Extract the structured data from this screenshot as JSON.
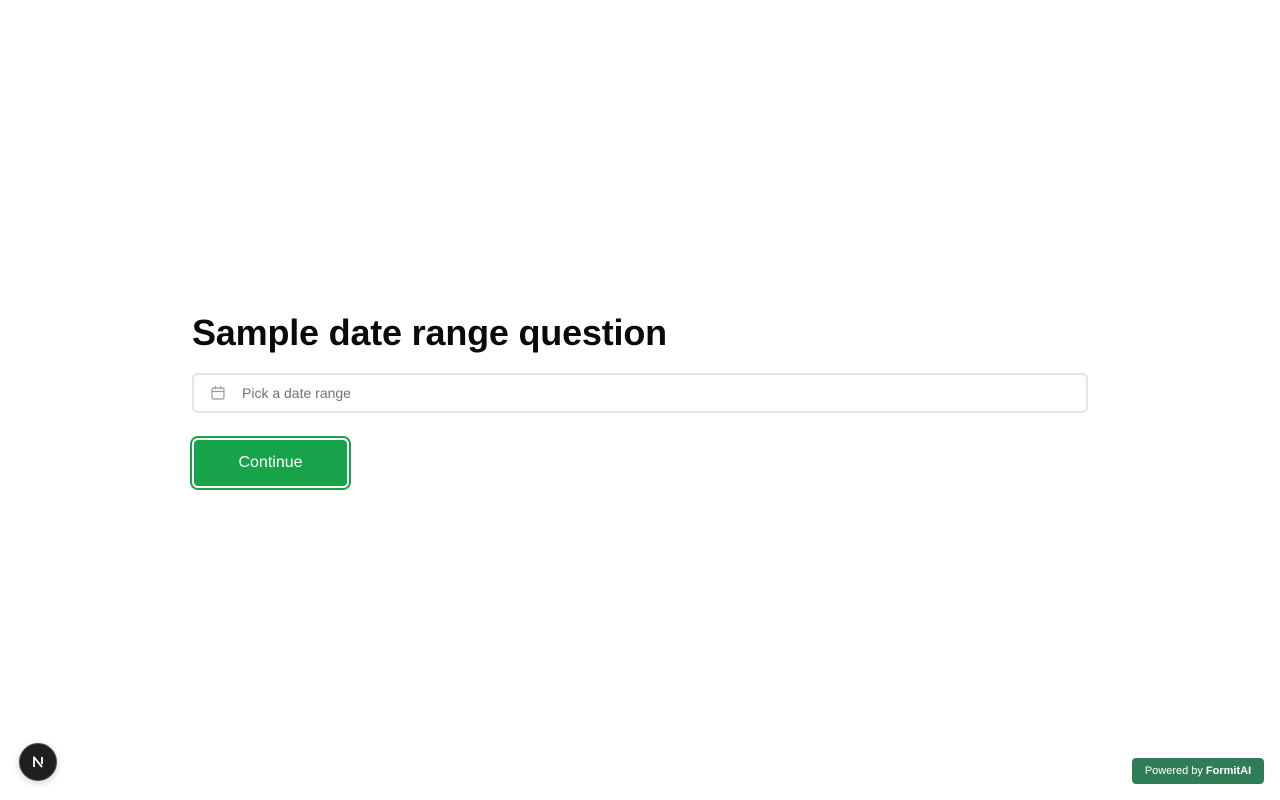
{
  "question": {
    "title": "Sample date range question"
  },
  "date_input": {
    "placeholder": "Pick a date range",
    "icon": "calendar-icon"
  },
  "actions": {
    "continue_label": "Continue"
  },
  "badges": {
    "next_letter": "N",
    "powered_prefix": "Powered by",
    "powered_brand": "FormitAI"
  },
  "colors": {
    "accent": "#16a34a",
    "powered_bg": "#2e7d57",
    "input_border": "#e5e5e5",
    "placeholder": "#737373"
  }
}
